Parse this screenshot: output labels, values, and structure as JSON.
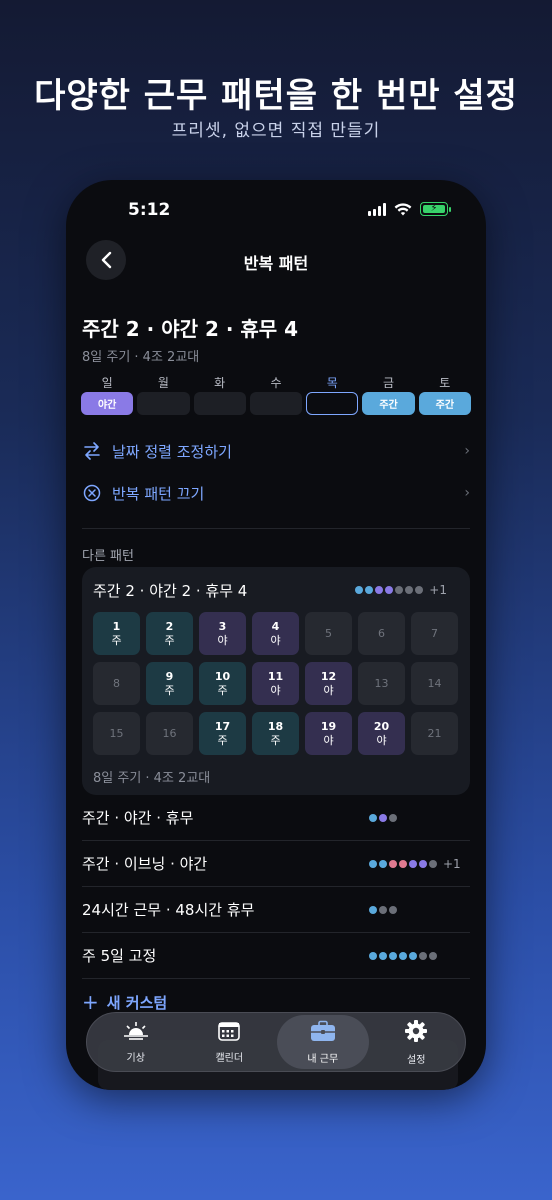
{
  "promo": {
    "headline": "다양한 근무 패턴을 한 번만 설정",
    "subline": "프리셋, 없으면 직접 만들기"
  },
  "status": {
    "time": "5:12"
  },
  "nav": {
    "title": "반복 패턴"
  },
  "current": {
    "title": "주간 2 · 야간 2 · 휴무 4",
    "subtitle": "8일 주기 · 4조 2교대",
    "weekdays": [
      {
        "label": "일",
        "shift": "야간",
        "type": "night"
      },
      {
        "label": "월",
        "shift": "",
        "type": "empty"
      },
      {
        "label": "화",
        "shift": "",
        "type": "empty"
      },
      {
        "label": "수",
        "shift": "",
        "type": "empty"
      },
      {
        "label": "목",
        "shift": "",
        "type": "today"
      },
      {
        "label": "금",
        "shift": "주간",
        "type": "day"
      },
      {
        "label": "토",
        "shift": "주간",
        "type": "day"
      }
    ]
  },
  "actions": {
    "align_label": "날짜 정렬 조정하기",
    "disable_label": "반복 패턴 끄기"
  },
  "other_patterns": {
    "section_label": "다른 패턴",
    "featured": {
      "title": "주간 2 · 야간 2 · 휴무 4",
      "more": "+1",
      "dot_colors": [
        "#5aa9dc",
        "#5aa9dc",
        "#8a7ae6",
        "#8a7ae6",
        "#6b6f78",
        "#6b6f78",
        "#6b6f78"
      ],
      "footer": "8일 주기 · 4조 2교대",
      "days": [
        {
          "n": "1",
          "t": "주",
          "type": "day"
        },
        {
          "n": "2",
          "t": "주",
          "type": "day"
        },
        {
          "n": "3",
          "t": "야",
          "type": "night"
        },
        {
          "n": "4",
          "t": "야",
          "type": "night"
        },
        {
          "n": "5",
          "t": "",
          "type": "off"
        },
        {
          "n": "6",
          "t": "",
          "type": "off"
        },
        {
          "n": "7",
          "t": "",
          "type": "off"
        },
        {
          "n": "8",
          "t": "",
          "type": "off"
        },
        {
          "n": "9",
          "t": "주",
          "type": "day"
        },
        {
          "n": "10",
          "t": "주",
          "type": "day"
        },
        {
          "n": "11",
          "t": "야",
          "type": "night"
        },
        {
          "n": "12",
          "t": "야",
          "type": "night"
        },
        {
          "n": "13",
          "t": "",
          "type": "off"
        },
        {
          "n": "14",
          "t": "",
          "type": "off"
        },
        {
          "n": "15",
          "t": "",
          "type": "off"
        },
        {
          "n": "16",
          "t": "",
          "type": "off"
        },
        {
          "n": "17",
          "t": "주",
          "type": "day"
        },
        {
          "n": "18",
          "t": "주",
          "type": "day"
        },
        {
          "n": "19",
          "t": "야",
          "type": "night"
        },
        {
          "n": "20",
          "t": "야",
          "type": "night"
        },
        {
          "n": "21",
          "t": "",
          "type": "off"
        }
      ]
    },
    "list": [
      {
        "label": "주간 · 야간 · 휴무",
        "dots": [
          "#5aa9dc",
          "#8a7ae6",
          "#6b6f78"
        ],
        "more": ""
      },
      {
        "label": "주간 · 이브닝 · 야간",
        "dots": [
          "#5aa9dc",
          "#5aa9dc",
          "#e07a90",
          "#e07a90",
          "#8a7ae6",
          "#8a7ae6",
          "#6b6f78"
        ],
        "more": "+1"
      },
      {
        "label": "24시간 근무 · 48시간 휴무",
        "dots": [
          "#5aa9dc",
          "#6b6f78",
          "#6b6f78"
        ],
        "more": ""
      },
      {
        "label": "주 5일 고정",
        "dots": [
          "#5aa9dc",
          "#5aa9dc",
          "#5aa9dc",
          "#5aa9dc",
          "#5aa9dc",
          "#6b6f78",
          "#6b6f78"
        ],
        "more": ""
      }
    ],
    "new_custom_label": "새 커스텀"
  },
  "tabbar": {
    "tabs": [
      {
        "label": "기상",
        "icon": "sunrise-icon"
      },
      {
        "label": "캘린더",
        "icon": "calendar-icon"
      },
      {
        "label": "내 근무",
        "icon": "briefcase-icon",
        "active": true
      },
      {
        "label": "설정",
        "icon": "gear-icon"
      }
    ]
  }
}
